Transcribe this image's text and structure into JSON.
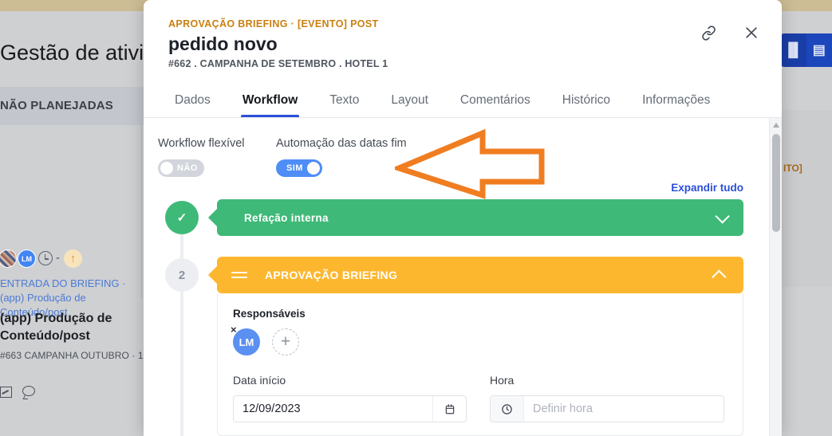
{
  "background": {
    "page_title": "Gestão de ativid",
    "column_header": "NÃO PLANEJADAS",
    "card": {
      "avatar_initials": "LM",
      "time_dash": "-",
      "up_arrow_icon": "arrow-up-icon",
      "link_line": "ENTRADA DO BRIEFING · (app) Produção de Conteúdo/post",
      "title": "(app) Produção de Conteúdo/post",
      "meta": "#663 CAMPANHA OUTUBRO · 1"
    },
    "top_buttons": [
      "⬚⬚",
      "⬚⬚"
    ],
    "right_panel_text": "ITO]"
  },
  "modal": {
    "eyebrow": "APROVAÇÃO BRIEFING · [EVENTO] POST",
    "title": "pedido novo",
    "subtitle": "#662 . CAMPANHA DE SETEMBRO . HOTEL 1",
    "actions": {
      "link_icon": "link-icon",
      "close_icon": "close-icon"
    },
    "tabs": [
      {
        "label": "Dados",
        "active": false
      },
      {
        "label": "Workflow",
        "active": true
      },
      {
        "label": "Texto",
        "active": false
      },
      {
        "label": "Layout",
        "active": false
      },
      {
        "label": "Comentários",
        "active": false
      },
      {
        "label": "Histórico",
        "active": false
      },
      {
        "label": "Informações",
        "active": false
      }
    ],
    "workflow": {
      "flexible_label": "Workflow flexível",
      "flexible_value": "NÃO",
      "automation_label": "Automação das datas fim",
      "automation_value": "SIM",
      "expand_all": "Expandir tudo",
      "steps": [
        {
          "marker": "✓",
          "title": "Refação interna",
          "state": "done",
          "chevron": "down"
        },
        {
          "marker": "2",
          "title": "APROVAÇÃO BRIEFING",
          "state": "current",
          "chevron": "up"
        }
      ],
      "details": {
        "responsaveis_label": "Responsáveis",
        "assignee_initials": "LM",
        "remove_label": "×",
        "add_label": "+",
        "data_inicio_label": "Data início",
        "data_inicio_value": "12/09/2023",
        "hora_label": "Hora",
        "hora_placeholder": "Definir hora"
      }
    }
  },
  "colors": {
    "accent_blue": "#2b50d8",
    "eyebrow_orange": "#c98010",
    "step_green": "#3fb978",
    "step_amber": "#fdb72f",
    "toggle_on": "#4f8df7",
    "toggle_off": "#d2d5db",
    "annotation_orange": "#f07d20"
  }
}
